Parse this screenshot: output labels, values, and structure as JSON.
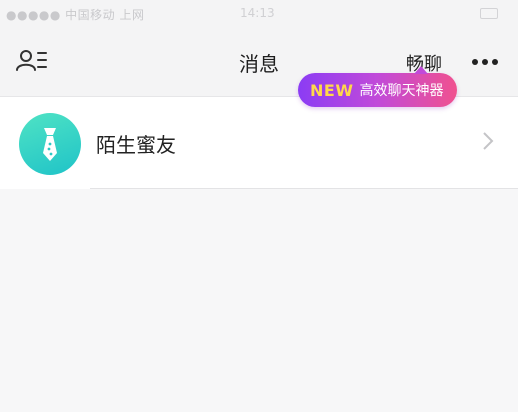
{
  "status_bar": {
    "left_text": "●●●●● 中国移动 上网",
    "time": "14:13"
  },
  "header": {
    "title": "消息",
    "chat_link": "畅聊",
    "contacts_icon": "contacts-list-icon",
    "more_icon": "more-dots-icon"
  },
  "badge": {
    "new_word": "NEW",
    "text": "高效聊天神器"
  },
  "list": {
    "items": [
      {
        "name": "陌生蜜友",
        "icon": "tie-icon"
      }
    ]
  },
  "colors": {
    "avatar": "#2cd2c6",
    "badge_start": "#8b3cf4",
    "badge_end": "#f0518f",
    "new_word": "#ffd84a"
  }
}
